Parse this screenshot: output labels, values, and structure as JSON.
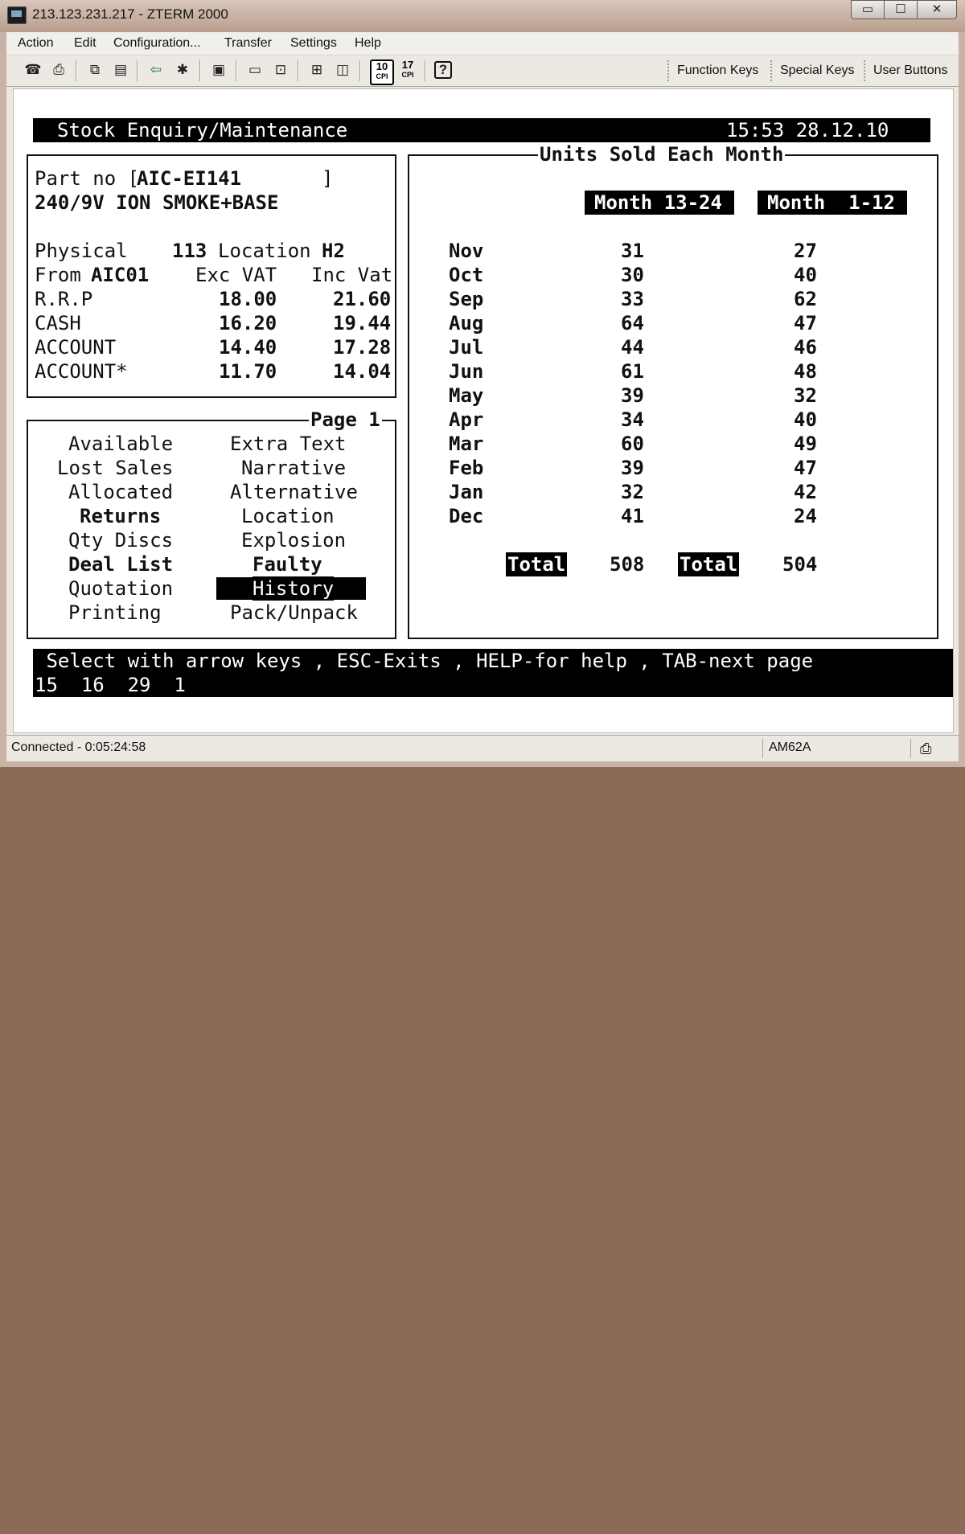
{
  "window": {
    "title": "213.123.231.217 - ZTERM 2000",
    "minimize": "▭",
    "maximize": "☐",
    "close": "✕"
  },
  "menu": [
    "Action",
    "Edit",
    "Configuration...",
    "Transfer",
    "Settings",
    "Help"
  ],
  "toolbar": {
    "cpi10_top": "10",
    "cpi10_bottom": "CPI",
    "cpi17_top": "17",
    "cpi17_bottom": "CPI",
    "function_keys": "Function Keys",
    "special_keys": "Special Keys",
    "user_buttons": "User Buttons"
  },
  "header": {
    "title": "Stock Enquiry/Maintenance",
    "clock": "15:53 28.12.10"
  },
  "part": {
    "label": "Part no [",
    "number": "AIC-EI141",
    "close_bracket": "]",
    "description": "240/9V ION SMOKE+BASE",
    "physical_label": "Physical",
    "physical_value": "113",
    "location_label": "Location",
    "location_value": "H2",
    "from_label": "From",
    "from_value": "AIC01",
    "exc_vat": "Exc VAT",
    "inc_vat": "Inc Vat",
    "prices": [
      {
        "label": "R.R.P",
        "exc": "18.00",
        "inc": "21.60"
      },
      {
        "label": "CASH",
        "exc": "16.20",
        "inc": "19.44"
      },
      {
        "label": "ACCOUNT",
        "exc": "14.40",
        "inc": "17.28"
      },
      {
        "label": "ACCOUNT*",
        "exc": "11.70",
        "inc": "14.04"
      }
    ]
  },
  "page_menu": {
    "title": "Page 1",
    "left": [
      "Available",
      "Lost Sales",
      "Allocated",
      "Returns",
      "Qty Discs",
      "Deal List",
      "Quotation",
      "Printing"
    ],
    "right": [
      "Extra Text",
      "Narrative",
      "Alternative",
      "Location",
      "Explosion",
      "Faulty",
      "History",
      "Pack/Unpack"
    ],
    "bold_left": [
      "Returns",
      "Deal List"
    ],
    "bold_right": [
      "Faulty"
    ],
    "selected": "History"
  },
  "units": {
    "title": "Units Sold Each Month",
    "col1": "Month 13-24",
    "col2": "Month  1-12",
    "rows": [
      {
        "month": "Nov",
        "m13_24": "31",
        "m1_12": "27"
      },
      {
        "month": "Oct",
        "m13_24": "30",
        "m1_12": "40"
      },
      {
        "month": "Sep",
        "m13_24": "33",
        "m1_12": "62"
      },
      {
        "month": "Aug",
        "m13_24": "64",
        "m1_12": "47"
      },
      {
        "month": "Jul",
        "m13_24": "44",
        "m1_12": "46"
      },
      {
        "month": "Jun",
        "m13_24": "61",
        "m1_12": "48"
      },
      {
        "month": "May",
        "m13_24": "39",
        "m1_12": "32"
      },
      {
        "month": "Apr",
        "m13_24": "34",
        "m1_12": "40"
      },
      {
        "month": "Mar",
        "m13_24": "60",
        "m1_12": "49"
      },
      {
        "month": "Feb",
        "m13_24": "39",
        "m1_12": "47"
      },
      {
        "month": "Jan",
        "m13_24": "32",
        "m1_12": "42"
      },
      {
        "month": "Dec",
        "m13_24": "41",
        "m1_12": "24"
      }
    ],
    "total_label": "Total",
    "total1": "508",
    "total2": "504"
  },
  "footer": {
    "help": " Select with arrow keys , ESC-Exits , HELP-for help , TAB-next page",
    "codes": "15  16  29  1"
  },
  "status": {
    "connected": "Connected - 0:05:24:58",
    "terminal": "AM62A"
  }
}
